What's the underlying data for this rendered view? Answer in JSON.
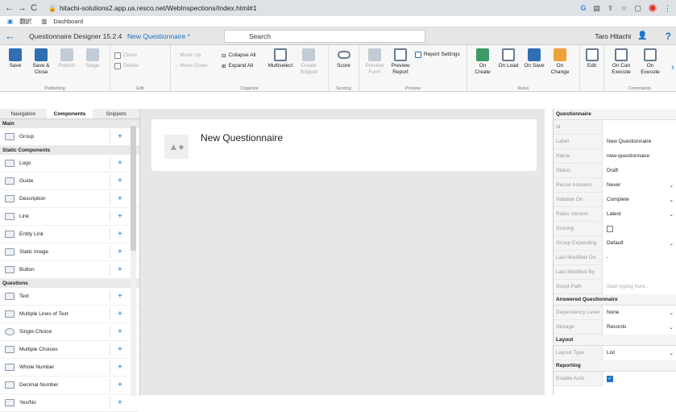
{
  "browser": {
    "url": "hitachi-solutions2.app.us.resco.net/WebInspections/Index.html#1",
    "bookmark1": "翻訳",
    "bookmark2": "Dashboard"
  },
  "header": {
    "app_title": "Questionnaire Designer 15.2.4",
    "tab_title": "New Questionnaire *",
    "search_placeholder": "Search",
    "user_name": "Taro Hitachi",
    "help": "?"
  },
  "ribbon": {
    "save": "Save",
    "save_close_1": "Save &",
    "save_close_2": "Close",
    "publish": "Publish",
    "stage": "Stage",
    "group_publishing": "Publishing",
    "clone": "Clone",
    "delete": "Delete",
    "group_edit": "Edit",
    "move_up": "Move Up",
    "move_down": "Move Down",
    "collapse_all": "Collapse All",
    "expand_all": "Expand All",
    "multiselect": "Multiselect",
    "create_snippet_1": "Create",
    "create_snippet_2": "Snippet",
    "group_organize": "Organize",
    "score": "Score",
    "group_scoring": "Scoring",
    "preview_form_1": "Preview",
    "preview_form_2": "Form",
    "preview_report_1": "Preview",
    "preview_report_2": "Report",
    "report_settings": "Report Settings",
    "group_preview": "Preview",
    "on_create": "On Create",
    "on_load": "On Load",
    "on_save": "On Save",
    "on_change_1": "On",
    "on_change_2": "Change",
    "edit": "Edit",
    "group_rules": "Rules",
    "on_can_execute_1": "On Can",
    "on_can_execute_2": "Execute",
    "on_execute_1": "On",
    "on_execute_2": "Execute",
    "group_commands": "Commands"
  },
  "left_panel": {
    "tabs": [
      "Navigation",
      "Components",
      "Snippets"
    ],
    "sec_main": "Main",
    "sec_static": "Static Components",
    "sec_questions": "Questions",
    "main_items": [
      "Group"
    ],
    "static_items": [
      "Logo",
      "Guide",
      "Description",
      "Link",
      "Entity Link",
      "Static Image",
      "Button"
    ],
    "question_items": [
      "Text",
      "Multiple Lines of Text",
      "Single Choice",
      "Multiple Choices",
      "Whole Number",
      "Decimal Number",
      "Yes/No"
    ]
  },
  "canvas": {
    "title": "New Questionnaire"
  },
  "properties": {
    "header": "Questionnaire",
    "rows": [
      {
        "k": "Id",
        "v": ""
      },
      {
        "k": "Label",
        "v": "New Questionnaire"
      },
      {
        "k": "Name",
        "v": "new-questionnaire"
      },
      {
        "k": "Status",
        "v": "Draft"
      },
      {
        "k": "Reuse Answers",
        "v": "Never"
      },
      {
        "k": "Validate On",
        "v": "Complete"
      },
      {
        "k": "Rules Version",
        "v": "Latest"
      },
      {
        "k": "Scoring",
        "v": ""
      },
      {
        "k": "Group Expanding",
        "v": "Default"
      },
      {
        "k": "Last Modified On",
        "v": "-"
      },
      {
        "k": "Last Modified By",
        "v": ""
      },
      {
        "k": "Script Path",
        "v": "Start typing here..."
      }
    ],
    "answered_header": "Answered Questionnaire",
    "answered_rows": [
      {
        "k": "Dependency Level",
        "v": "None"
      },
      {
        "k": "Storage",
        "v": "Records"
      }
    ],
    "layout_header": "Layout",
    "layout_rows": [
      {
        "k": "Layout Type",
        "v": "List"
      }
    ],
    "reporting_header": "Reporting",
    "reporting_rows": [
      {
        "k": "Enable Auto",
        "v": ""
      }
    ]
  }
}
